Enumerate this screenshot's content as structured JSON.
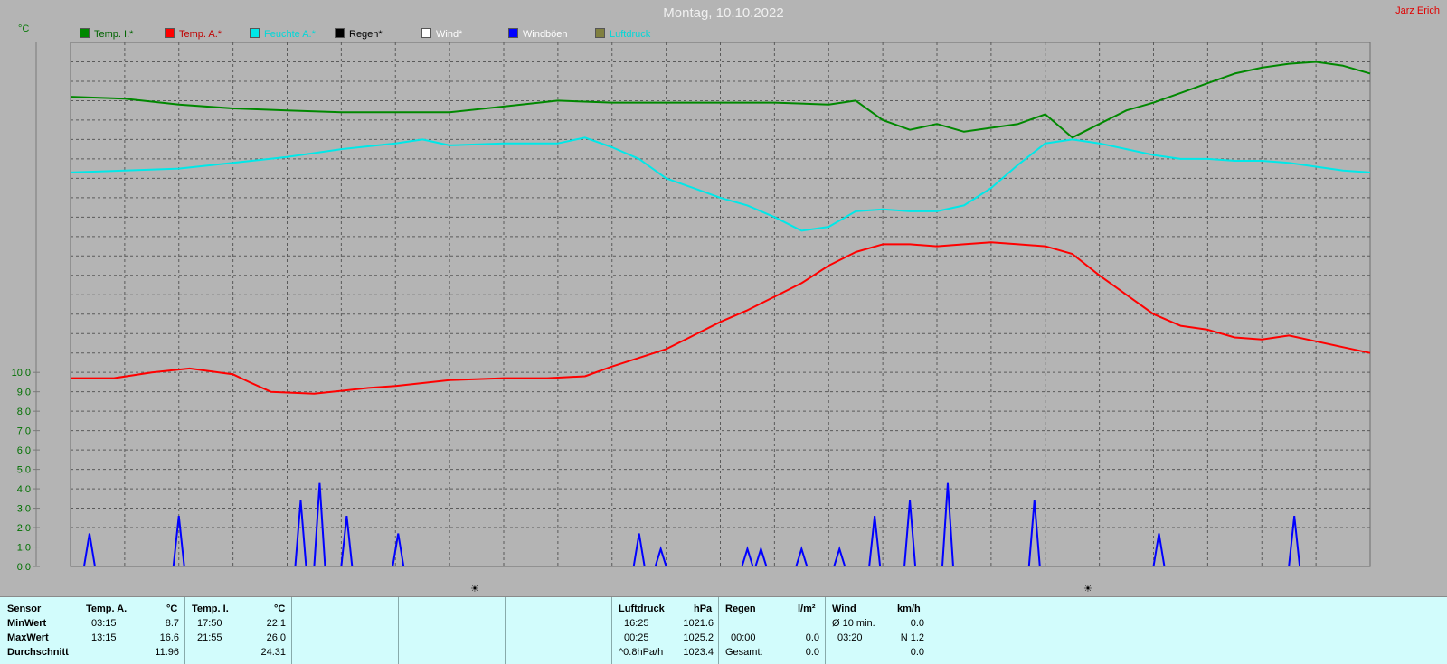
{
  "title": "Montag, 10.10.2022",
  "author": "Jarz Erich",
  "unit": "°C",
  "legend": [
    {
      "label": "Temp. I.*",
      "color": "#00a000",
      "text_color": "#006400"
    },
    {
      "label": "Temp. A.*",
      "color": "#ff0000",
      "text_color": "#c00000"
    },
    {
      "label": "Feuchte A.*",
      "color": "#00e8e8",
      "text_color": "#00d8d8"
    },
    {
      "label": "Regen*",
      "color": "#000000",
      "text_color": "#000000"
    },
    {
      "label": "Wind*",
      "color": "#ffffff",
      "text_color": "#ffffff"
    },
    {
      "label": "Windböen",
      "color": "#0000ff",
      "text_color": "#ffffff"
    },
    {
      "label": "Luftdruck",
      "color": "#808040",
      "text_color": "#00d8d8"
    }
  ],
  "chart_data": {
    "type": "line",
    "x_range": [
      0,
      24
    ],
    "yticks": [
      "0.0",
      "1.0",
      "2.0",
      "3.0",
      "4.0",
      "5.0",
      "6.0",
      "7.0",
      "8.0",
      "9.0",
      "10.0"
    ],
    "ylim": [
      0,
      27
    ],
    "grid": true,
    "series": [
      {
        "name": "Temp. A.*",
        "color": "#ff0000",
        "x": [
          0,
          0.8,
          1.5,
          2.2,
          3.0,
          3.3,
          3.7,
          4.5,
          5.5,
          6.0,
          7.0,
          8.0,
          8.8,
          9.5,
          10.0,
          11.0,
          11.5,
          12.0,
          12.5,
          13.0,
          13.5,
          14.0,
          14.5,
          15.0,
          15.5,
          16.0,
          16.5,
          17.0,
          17.5,
          18.0,
          18.5,
          19.0,
          19.5,
          20.0,
          20.5,
          21.0,
          21.5,
          22.0,
          22.5,
          23.0,
          23.5,
          24.0
        ],
        "y": [
          9.7,
          9.7,
          10.0,
          10.2,
          9.9,
          9.5,
          9.0,
          8.9,
          9.2,
          9.3,
          9.6,
          9.7,
          9.7,
          9.8,
          10.3,
          11.2,
          11.9,
          12.6,
          13.2,
          13.9,
          14.6,
          15.5,
          16.2,
          16.6,
          16.6,
          16.5,
          16.6,
          16.7,
          16.6,
          16.5,
          16.1,
          15.0,
          14.0,
          13.0,
          12.4,
          12.2,
          11.8,
          11.7,
          11.9,
          11.6,
          11.3,
          11.0
        ]
      },
      {
        "name": "Temp. I.*",
        "color": "#008800",
        "x": [
          0,
          1.0,
          2.0,
          3.0,
          4.0,
          5.0,
          6.0,
          7.0,
          8.0,
          9.0,
          10.0,
          11.0,
          12.0,
          13.0,
          14.0,
          14.5,
          15.0,
          15.5,
          16.0,
          16.5,
          17.0,
          17.5,
          18.0,
          18.5,
          19.0,
          19.5,
          20.0,
          20.5,
          21.0,
          21.5,
          22.0,
          22.5,
          23.0,
          23.5,
          24.0
        ],
        "y": [
          24.2,
          24.1,
          23.8,
          23.6,
          23.5,
          23.4,
          23.4,
          23.4,
          23.7,
          24.0,
          23.9,
          23.9,
          23.9,
          23.9,
          23.8,
          24.0,
          23.0,
          22.5,
          22.8,
          22.4,
          22.6,
          22.8,
          23.3,
          22.1,
          22.8,
          23.5,
          23.9,
          24.4,
          24.9,
          25.4,
          25.7,
          25.9,
          26.0,
          25.8,
          25.4
        ]
      },
      {
        "name": "Feuchte A.*",
        "color": "#00e8e8",
        "x": [
          0,
          1.0,
          2.0,
          3.0,
          4.0,
          5.0,
          6.0,
          6.5,
          7.0,
          8.0,
          9.0,
          9.5,
          10.0,
          10.5,
          11.0,
          11.5,
          12.0,
          12.5,
          13.0,
          13.5,
          14.0,
          14.5,
          15.0,
          15.5,
          16.0,
          16.5,
          17.0,
          17.5,
          18.0,
          18.5,
          19.0,
          19.5,
          20.0,
          20.5,
          21.0,
          21.5,
          22.0,
          22.5,
          23.0,
          23.5,
          24.0
        ],
        "y": [
          20.3,
          20.4,
          20.5,
          20.8,
          21.1,
          21.5,
          21.8,
          22.0,
          21.7,
          21.8,
          21.8,
          22.1,
          21.6,
          21.0,
          20.0,
          19.5,
          19.0,
          18.6,
          18.0,
          17.3,
          17.5,
          18.3,
          18.4,
          18.3,
          18.3,
          18.6,
          19.5,
          20.7,
          21.8,
          22.0,
          21.8,
          21.5,
          21.2,
          21.0,
          21.0,
          20.9,
          20.9,
          20.8,
          20.6,
          20.4,
          20.3
        ]
      },
      {
        "name": "Windböen",
        "color": "#0000ff",
        "x": [
          0.35,
          2.0,
          4.25,
          4.6,
          5.1,
          6.05,
          10.5,
          10.9,
          12.5,
          12.75,
          13.5,
          14.2,
          14.85,
          15.5,
          16.2,
          17.8,
          20.1,
          22.6,
          24.0
        ],
        "y": [
          1.7,
          2.6,
          3.4,
          4.3,
          2.6,
          1.7,
          1.7,
          0.9,
          0.9,
          0.9,
          0.9,
          0.9,
          2.6,
          3.4,
          4.3,
          3.4,
          1.7,
          2.6,
          0
        ],
        "render": "spikes"
      }
    ]
  },
  "markers": [
    "☀",
    "☀"
  ],
  "stats": {
    "sensor_label": "Sensor",
    "minwert_label": "MinWert",
    "maxwert_label": "MaxWert",
    "durchschnitt_label": "Durchschnitt",
    "temp_a": {
      "header": "Temp. A.",
      "unit": "°C",
      "min_time": "03:15",
      "min": "8.7",
      "max_time": "13:15",
      "max": "16.6",
      "avg": "11.96"
    },
    "temp_i": {
      "header": "Temp. I.",
      "unit": "°C",
      "min_time": "17:50",
      "min": "22.1",
      "max_time": "21:55",
      "max": "26.0",
      "avg": "24.31"
    },
    "luftdruck": {
      "header": "Luftdruck",
      "unit": "hPa",
      "min_time": "16:25",
      "min": "1021.6",
      "max_time": "00:25",
      "max": "1025.2",
      "avg_label": "^0.8hPa/h",
      "avg": "1023.4"
    },
    "regen": {
      "header": "Regen",
      "unit": "l/m²",
      "max_time": "00:00",
      "max": "0.0",
      "total_label": "Gesamt:",
      "total": "0.0"
    },
    "wind": {
      "header": "Wind",
      "unit": "km/h",
      "min_label": "Ø 10 min.",
      "min": "0.0",
      "max_time": "03:20",
      "max": "N 1.2",
      "avg": "0.0"
    }
  }
}
